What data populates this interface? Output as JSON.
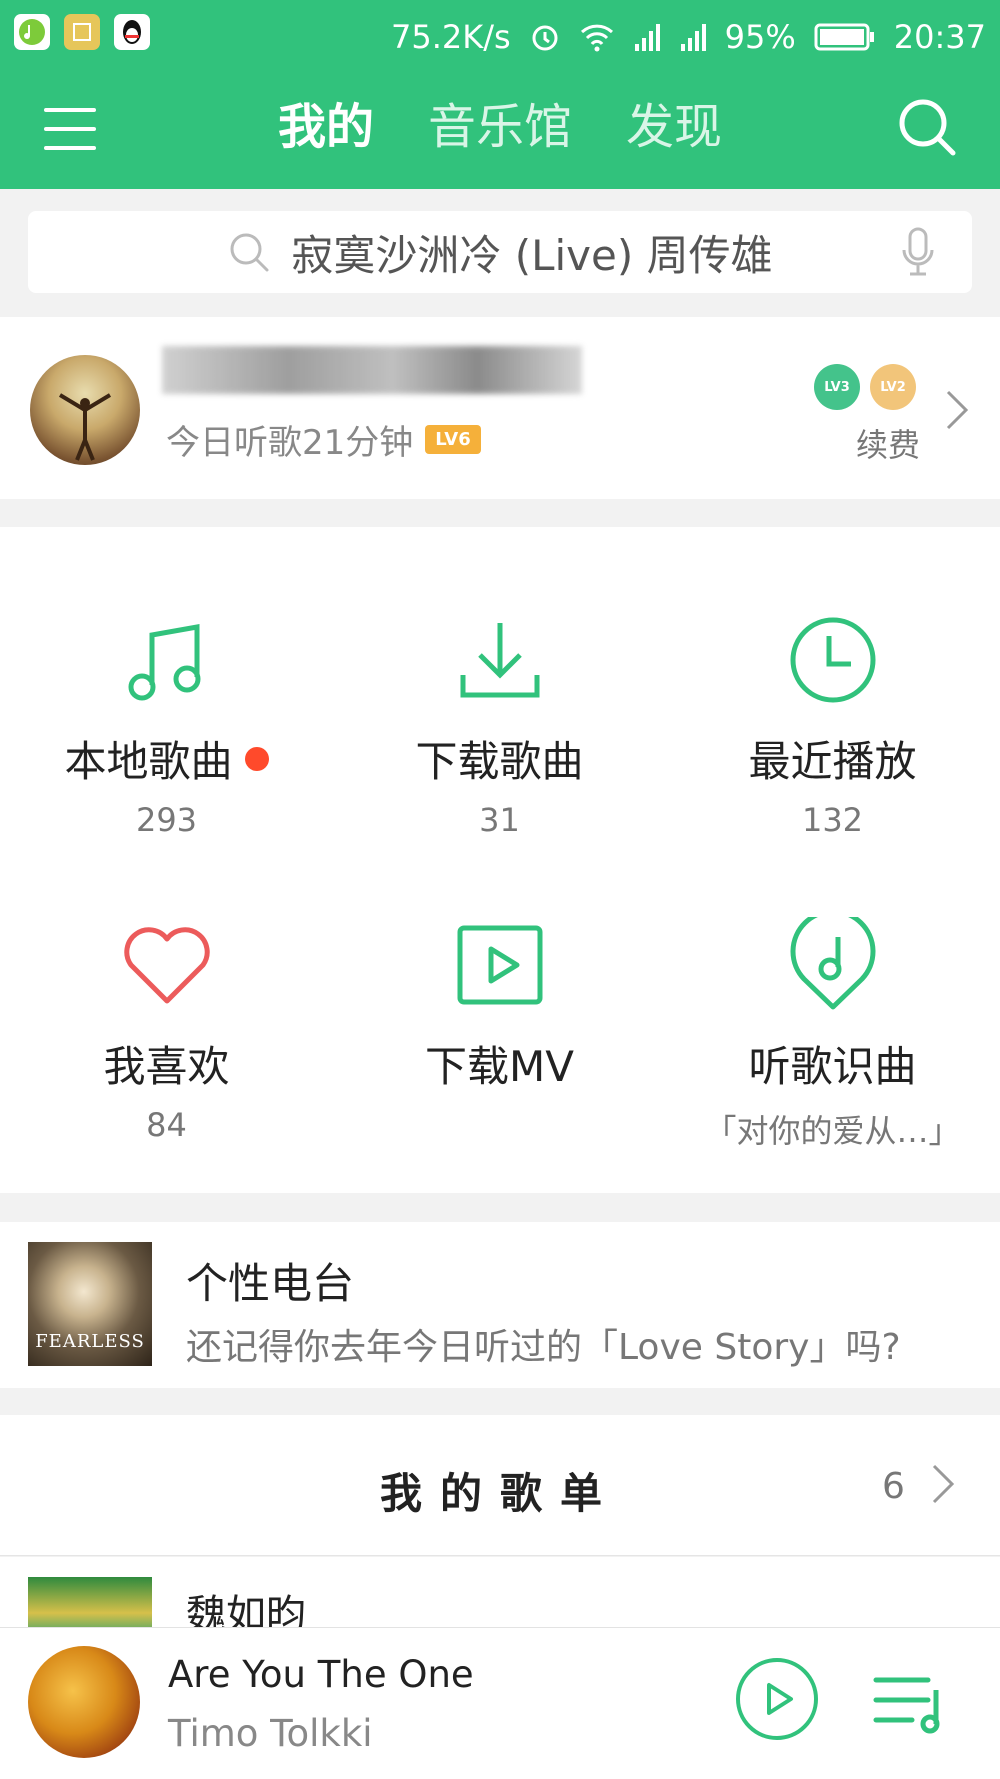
{
  "status": {
    "speed": "75.2K/s",
    "battery": "95%",
    "time": "20:37"
  },
  "header": {
    "tabs": [
      "我的",
      "音乐馆",
      "发现"
    ],
    "active_tab": 0
  },
  "search": {
    "placeholder": "寂寞沙洲冷 (Live) 周传雄"
  },
  "profile": {
    "listen_today": "今日听歌21分钟",
    "level": "LV6",
    "badges": [
      "LV3",
      "LV2"
    ],
    "renew": "续费"
  },
  "grid": [
    {
      "label": "本地歌曲",
      "count": "293",
      "icon": "music-note-icon",
      "has_dot": true
    },
    {
      "label": "下载歌曲",
      "count": "31",
      "icon": "download-icon"
    },
    {
      "label": "最近播放",
      "count": "132",
      "icon": "clock-icon"
    },
    {
      "label": "我喜欢",
      "count": "84",
      "icon": "heart-icon"
    },
    {
      "label": "下载MV",
      "count": "",
      "icon": "play-box-icon"
    },
    {
      "label": "听歌识曲",
      "count": "「对你的爱从…」",
      "icon": "music-pin-icon"
    }
  ],
  "radio": {
    "title": "个性电台",
    "subtitle": "还记得你去年今日听过的「Love Story」吗?",
    "cover_text": "FEARLESS"
  },
  "playlists": {
    "title": "我的歌单",
    "count": "6",
    "first_item": "魏如昀"
  },
  "player": {
    "song": "Are You The One",
    "artist": "Timo Tolkki"
  },
  "colors": {
    "brand": "#31c27c",
    "dot": "#ff4a2b",
    "heart": "#ec5b5b"
  }
}
